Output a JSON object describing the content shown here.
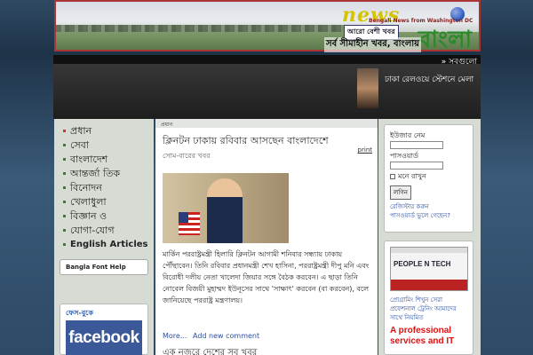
{
  "header": {
    "logo_news": "news",
    "logo_sub": "Bengali News from Washington DC",
    "logo_bangla": "বাংলা",
    "logo_tag": "আরো বেশী খবর",
    "slogan": "সর্ব সীমাহীন খবর, বাংলায়"
  },
  "featured": {
    "more_link": "» সবগুলো",
    "story_title": "ঢাকা রেলওয়ে স্টেশনে মেলা"
  },
  "nav": {
    "items": [
      {
        "label": "প্রধান"
      },
      {
        "label": "সেবা"
      },
      {
        "label": "বাংলাদেশ"
      },
      {
        "label": "আন্তর্জা তিক"
      },
      {
        "label": "বিনোদন"
      },
      {
        "label": "খেলাধুলা"
      },
      {
        "label": "বিজ্ঞান ও"
      },
      {
        "label": "যোগা-যোগ"
      },
      {
        "label": "English Articles"
      }
    ],
    "font_help": "Bangla Font Help",
    "facebook_heading": "ফেস-বুকে",
    "facebook_label": "facebook"
  },
  "main": {
    "crumb": "প্রধান",
    "headline": "ক্লিনটন ঢাকায় রবিবার আসছেন বাংলাদেশে",
    "print": "print",
    "date": "সোম-বারের খবর",
    "body": "মার্কিন পররাষ্ট্রমন্ত্রী হিলারি ক্লিনটন আগামী শনিবার সন্ধ্যায় ঢাকায় পৌঁছাবেন। তিনি রবিবার প্রধানমন্ত্রী শেখ হাসিনা, পররাষ্ট্রমন্ত্রী দীপু মনি এবং বিরোধী দলীয় নেতা খালেদা জিয়ার সঙ্গে বৈঠক করবেন। এ ছাড়া তিনি নোবেল বিজয়ী মুহাম্মদ ইউনূসের সাথে 'সাক্ষাৎ' করবেন (বা করবেন), বলে জানিয়েছে পররাষ্ট্র মন্ত্রণালয়।",
    "more": "More...",
    "add_comment": "Add new comment",
    "next_headline": "এক নজরে দেশের সব খবর"
  },
  "login": {
    "user_label": "ইউজার নেম",
    "user_placeholder": "",
    "pass_label": "পাসওয়ার্ড",
    "pass_placeholder": "",
    "remember": "মনে রাখুন",
    "login_button": "লগিন",
    "register": "রেজিস্টার করুন",
    "forgot": "পাসওয়ার্ড ভুলে গেছেন?"
  },
  "ad": {
    "brand": "PEOPLE N TECH",
    "blue_text": "প্রোগ্রামিং শিখুন সেরা প্রফেশনাল ট্রেনিং আমাদের সাথে নিয়মিত",
    "red_text": "A professional services and IT"
  }
}
